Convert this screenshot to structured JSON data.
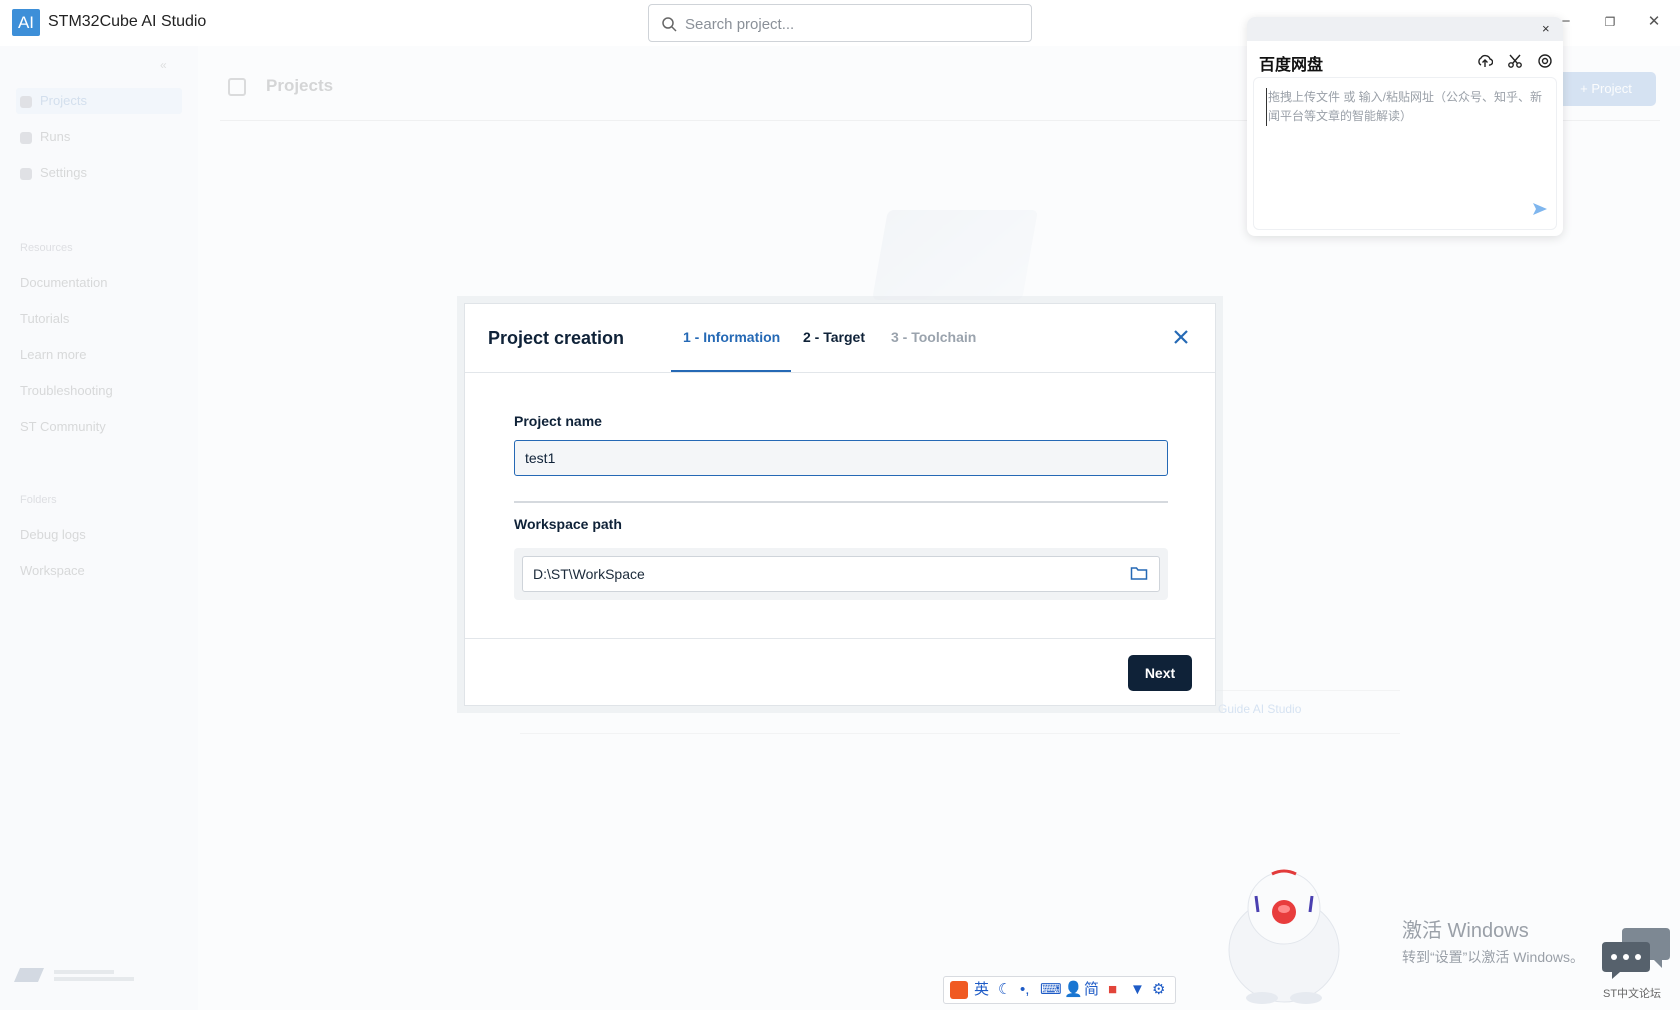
{
  "app": {
    "logo": "AI",
    "title": "STM32Cube AI Studio"
  },
  "search": {
    "placeholder": "Search project..."
  },
  "window_controls": {
    "minimize": "−",
    "restore": "❐",
    "close": "✕"
  },
  "sidebar": {
    "collapse_glyph": "«",
    "items": [
      {
        "label": "Projects",
        "active": true
      },
      {
        "label": "Runs"
      },
      {
        "label": "Settings"
      }
    ],
    "resources_heading": "Resources",
    "resources": [
      "Documentation",
      "Tutorials",
      "Learn more",
      "Troubleshooting",
      "ST Community"
    ],
    "folders_heading": "Folders",
    "folders": [
      "Debug logs",
      "Workspace"
    ]
  },
  "main": {
    "title": "Projects",
    "add_button": "+ Project",
    "hint_link": "Guide AI Studio"
  },
  "modal": {
    "title": "Project creation",
    "tabs": [
      {
        "label": "1 - Information",
        "state": "active"
      },
      {
        "label": "2 - Target",
        "state": "enabled"
      },
      {
        "label": "3 - Toolchain",
        "state": "disabled"
      }
    ],
    "project_name_label": "Project name",
    "project_name_value": "test1",
    "workspace_label": "Workspace path",
    "workspace_value": "D:\\ST\\WorkSpace",
    "next_label": "Next",
    "accent_color": "#2569b5",
    "primary_color": "#0f2238"
  },
  "baidu_panel": {
    "close": "×",
    "title": "百度网盘",
    "placeholder": "拖拽上传文件 或 输入/粘贴网址（公众号、知乎、新闻平台等文章的智能解读）"
  },
  "windows_activation": {
    "line1": "激活 Windows",
    "line2": "转到“设置”以激活 Windows。"
  },
  "forum_label": "ST中文论坛",
  "ime": {
    "lang": "英",
    "mode": "简"
  }
}
